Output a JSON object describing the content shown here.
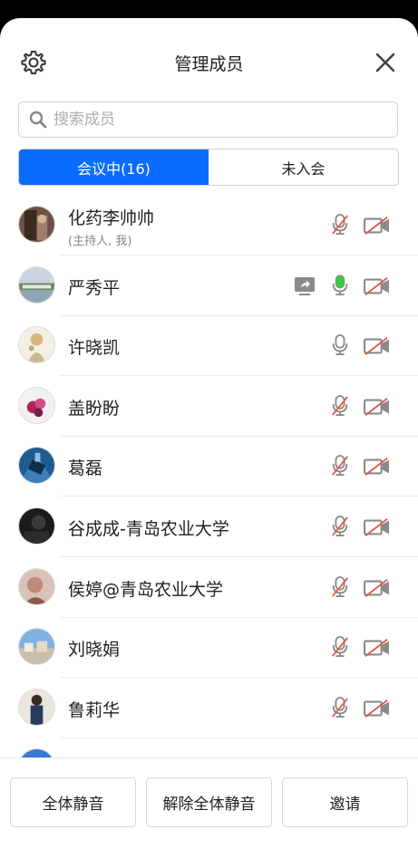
{
  "header": {
    "title": "管理成员",
    "settings_icon": "gear-icon",
    "close_icon": "close-icon"
  },
  "search": {
    "placeholder": "搜索成员",
    "value": ""
  },
  "tabs": [
    {
      "label": "会议中(16)",
      "active": true
    },
    {
      "label": "未入会",
      "active": false
    }
  ],
  "members": [
    {
      "name": "化药李帅帅",
      "subtitle": "(主持人, 我)",
      "mic": "muted",
      "camera": "off",
      "screen_share": false
    },
    {
      "name": "严秀平",
      "subtitle": "",
      "mic": "speaking",
      "camera": "off",
      "screen_share": true
    },
    {
      "name": "许晓凯",
      "subtitle": "",
      "mic": "on",
      "camera": "off",
      "screen_share": false
    },
    {
      "name": "盖盼盼",
      "subtitle": "",
      "mic": "muted",
      "camera": "off",
      "screen_share": false
    },
    {
      "name": "葛磊",
      "subtitle": "",
      "mic": "muted",
      "camera": "off",
      "screen_share": false
    },
    {
      "name": "谷成成-青岛农业大学",
      "subtitle": "",
      "mic": "muted",
      "camera": "off",
      "screen_share": false
    },
    {
      "name": "侯婷@青岛农业大学",
      "subtitle": "",
      "mic": "muted",
      "camera": "off",
      "screen_share": false
    },
    {
      "name": "刘晓娟",
      "subtitle": "",
      "mic": "muted",
      "camera": "off",
      "screen_share": false
    },
    {
      "name": "鲁莉华",
      "subtitle": "",
      "mic": "muted",
      "camera": "off",
      "screen_share": false
    }
  ],
  "footer": {
    "mute_all": "全体静音",
    "unmute_all": "解除全体静音",
    "invite": "邀请"
  },
  "colors": {
    "accent": "#0a6cff",
    "mic_speaking": "#2fd13f",
    "muted_slash": "#e05a4a",
    "icon_gray": "#8a8a8a"
  }
}
